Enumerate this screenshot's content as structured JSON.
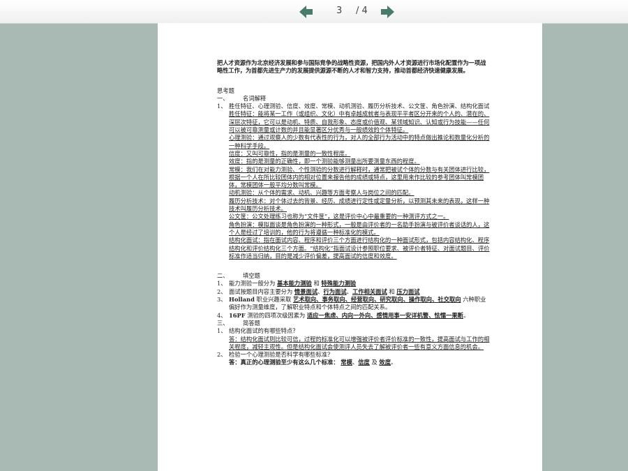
{
  "toolbar": {
    "current_page": "3",
    "total_pages": "/ 4",
    "prev_icon": "arrow-left-icon",
    "next_icon": "arrow-right-icon",
    "accent": "#4a7a6a"
  },
  "doc": {
    "intro": "把人才资源作为北京经济发展和参与国际竞争的战略性资源，把国内外人才资源进行市场化配置作为一项战略性工作，为首都先进生产力的发展提供源源不断的人才和智力支持，推动首都经济快速健康发展。",
    "section_title": "思考题",
    "part1": {
      "num": "一、",
      "title": "名词解释"
    },
    "q1_num": "1、",
    "q1_text": "胜任特征、心理测验、信度、效度、常模、动机测验、履历分析技术、公文筐、角色扮演、结构化面试",
    "defs": [
      "胜任特征：能将某一工作（或组织、文化）中有卓越成就者与表现平平者区分开来的个人的、潜在的、深层次特征，它可以是动机、特质、自我形象、态度或价值观、某领域知识、认知或行为技能——任何可以被可靠测量或计数的并且能显著区分优秀与一般绩效的个体特征。",
      "心理测验：通过观察人的少数有代表性的行为，对人的全部行为活动中的特点做出推论和数量化分析的一种科学手段。",
      "信度：又叫可靠性，指的是测量的一致性程度。",
      "效度：指的是测量的正确性，即一个测验能够测量出所要测量东西的程度。",
      "常模：我们在对能力测验、个性测验的分数进行解释时，通常把被试个体的分数与有关团体进行比较，根据一个人在所比较团体内的相对位置来报告他的成绩或特点，这里用来作比较的参考团体叫常模团体，常模团体一般平均分数叫常模。",
      "动机测验：从个体的需求、动机、兴趣等方面考察人与岗位之间的匹配。",
      "履历分析技术：对个体过去的背景、经历、成绩进行定性或定量分析，以预测其未来的表现，这样一种技术叫履历分析技术。",
      "公文筐：公文处理练习也称为“文件筐”，这是评价中心中最重要的一种测评方式之一。",
      "角色扮演：模拟面谈是角色扮演的一种形式，一般是由评价者的一名助手扮演与被评价者谈话的人，这个人是经过了培训的，他的行为将遵循一种标准化的模式。",
      "结构化面试：指在面试内容、程序和评价三个方面进行结构化的一种面试形式，包括内容结构化、程序结构化和评价结构化三个方面。“结构化”指面试设计参照职位要求、被评价者特征、对面试题目、评价标准作适当归纳，目的是减少评价偏差，提高面试的信度和效度。"
    ],
    "part2": {
      "num": "二、",
      "title": "填空题"
    },
    "fill": [
      {
        "num": "1、",
        "pre": "能力测验一般分为",
        "a": "基本能力测验",
        "mid": "和",
        "b": "特殊能力测验"
      },
      {
        "num": "2、",
        "pre": "面试按题目内容主要分为",
        "a": "情景面试",
        "sep1": "、",
        "b": "行为面试",
        "sep2": "、",
        "c": "工作相关面试",
        "mid": "和",
        "d": "压力面试"
      },
      {
        "num": "3、",
        "pre": "Holland",
        "pre2": "职业兴趣采取",
        "a": "艺术取向、事务取向、经营取向、研究取向、操作取向、社交取向",
        "post": "六种职业偏好作为测量维度，了解职业特点和个体特点之间的匹配关系。"
      },
      {
        "num": "4、",
        "pre": "16PF",
        "pre2": "测验的四项次级因素为",
        "a": "适应一焦虑、内向一外向、感情用事一安详机警、怯懦一果断",
        "post": "。"
      }
    ],
    "part3": {
      "num": "三、",
      "title": "简答题"
    },
    "qa": [
      {
        "num": "1、",
        "q": "结构化面试的有哪些特点？",
        "a": "答：结构化面试则比较可信，过程的标准化可以增强被评价者评价标准的一致性，提高面试与工作的相关程度，减轻主观性。但是结构化面试会使测评人员失去了解被评价者一些有意义方面信息的机会。"
      },
      {
        "num": "2、",
        "q": "检验一个心理测验是否科学有哪些标准？",
        "a_pre": "答：真正的心理测验至少有这么几个标准：",
        "a1": "常模",
        "sep": "、",
        "a2": "信度",
        "mid": "及",
        "a3": "效度",
        "end": "。"
      }
    ]
  }
}
